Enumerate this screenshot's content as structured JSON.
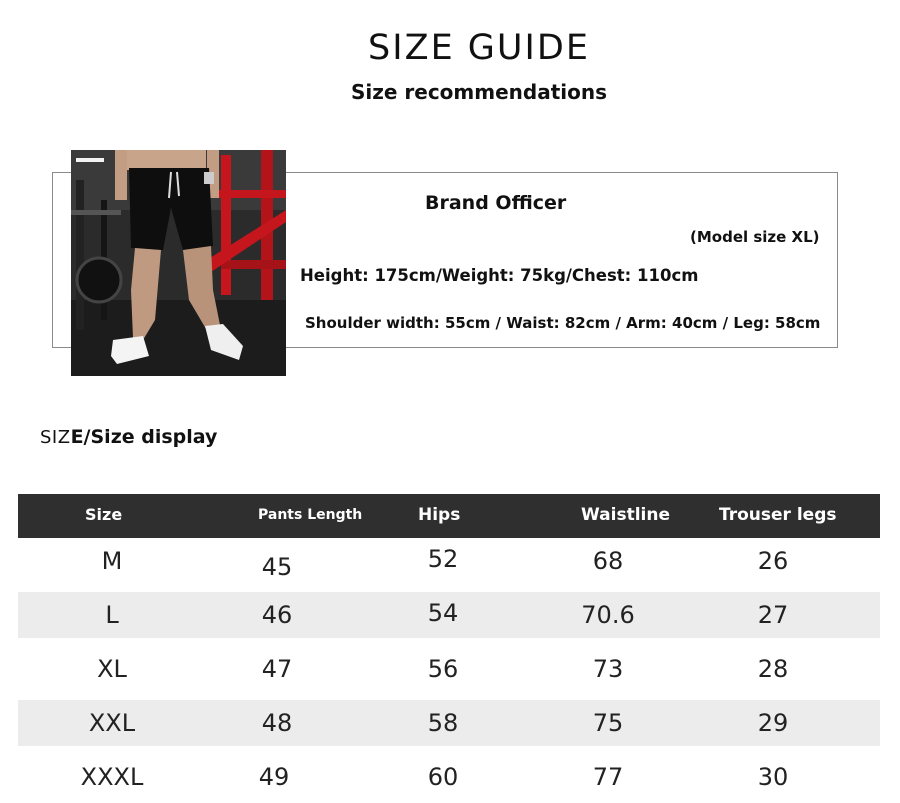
{
  "header": {
    "title": "SIZE GUIDE",
    "subtitle": "Size recommendations"
  },
  "model": {
    "name": "Brand Officer",
    "size_note": "(Model size XL)",
    "line1": "Height: 175cm/Weight: 75kg/Chest: 110cm",
    "line2": "Shoulder width: 55cm / Waist: 82cm / Arm: 40cm / Leg: 58cm"
  },
  "section": {
    "prefix": "SIZ",
    "heading": "E/Size display"
  },
  "table": {
    "headers": [
      "Size",
      "Pants Length",
      "Hips",
      "Waistline",
      "Trouser legs"
    ],
    "rows": [
      [
        "M",
        "45",
        "52",
        "68",
        "26"
      ],
      [
        "L",
        "46",
        "54",
        "70.6",
        "27"
      ],
      [
        "XL",
        "47",
        "56",
        "73",
        "28"
      ],
      [
        "XXL",
        "48",
        "58",
        "75",
        "29"
      ],
      [
        "XXXL",
        "49",
        "60",
        "77",
        "30"
      ]
    ]
  }
}
